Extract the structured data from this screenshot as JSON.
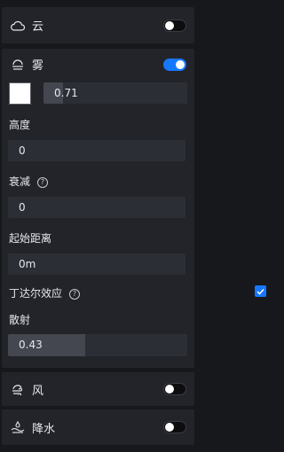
{
  "cloud": {
    "label": "云",
    "icon": "cloud-icon",
    "enabled": false
  },
  "fog": {
    "label": "雾",
    "icon": "fog-icon",
    "enabled": true,
    "color": "#ffffff",
    "opacity": {
      "value": "0.71",
      "fraction": 0.71
    },
    "height": {
      "label": "高度",
      "value": "0"
    },
    "attenuation": {
      "label": "衰减",
      "value": "0"
    },
    "start_distance": {
      "label": "起始距离",
      "value": "0m"
    },
    "tyndall": {
      "label": "丁达尔效应",
      "checked": true
    },
    "scatter": {
      "label": "散射",
      "value": "0.43",
      "fraction": 0.43
    }
  },
  "wind": {
    "label": "风",
    "icon": "wind-icon",
    "enabled": false
  },
  "precipitation": {
    "label": "降水",
    "icon": "precipitation-icon",
    "enabled": false
  },
  "colors": {
    "accent": "#1677ff",
    "panel": "#232429",
    "field": "#2c2e35",
    "background": "#17181c"
  }
}
